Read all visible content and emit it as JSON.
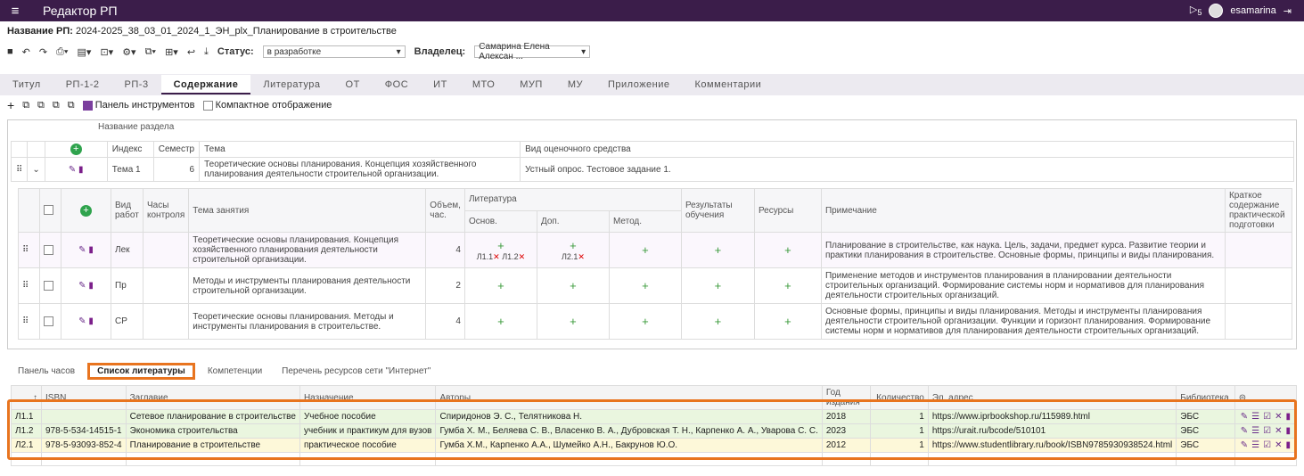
{
  "app": {
    "title": "Редактор РП",
    "user": "esamarina",
    "badge": "5"
  },
  "rp": {
    "label": "Название РП:",
    "value": "2024-2025_38_03_01_2024_1_ЭН_plx_Планирование в строительстве"
  },
  "toolbar": {
    "status_label": "Статус:",
    "status_value": "в разработке",
    "owner_label": "Владелец:",
    "owner_value": "Самарина Елена Алексан ..."
  },
  "tabs": [
    "Титул",
    "РП-1-2",
    "РП-3",
    "Содержание",
    "Литература",
    "ОТ",
    "ФОС",
    "ИТ",
    "МТО",
    "МУП",
    "МУ",
    "Приложение",
    "Комментарии"
  ],
  "tools": {
    "panel_label": "Панель инструментов",
    "compact_label": "Компактное отображение"
  },
  "section": {
    "header": "Название раздела"
  },
  "outer": {
    "headers": {
      "index": "Индекс",
      "semester": "Семестр",
      "theme": "Тема",
      "assess": "Вид оценочного средства"
    },
    "row": {
      "index": "Тема 1",
      "semester": "6",
      "theme": "Теоретические основы планирования. Концепция хозяйственного планирования деятельности строительной организации.",
      "assess": "Устный опрос. Тестовое задание 1."
    }
  },
  "inner": {
    "headers": {
      "type": "Вид работ",
      "hours": "Часы контроля",
      "topic": "Тема занятия",
      "vol": "Объем, час.",
      "lit": "Литература",
      "main": "Основ.",
      "add": "Доп.",
      "meth": "Метод.",
      "results": "Результаты обучения",
      "resources": "Ресурсы",
      "note": "Примечание",
      "summary": "Краткое содержание практической подготовки"
    },
    "rows": [
      {
        "type": "Лек",
        "topic": "Теоретические основы планирования. Концепция хозяйственного планирования деятельности строительной организации.",
        "vol": "4",
        "main_refs": [
          "Л1.1",
          "Л1.2"
        ],
        "add_refs": [
          "Л2.1"
        ],
        "note": "Планирование в строительстве, как наука. Цель, задачи, предмет курса. Развитие теории и практики планирования в строительстве. Основные формы, принципы и виды планирования."
      },
      {
        "type": "Пр",
        "topic": "Методы и инструменты планирования деятельности строительной организации.",
        "vol": "2",
        "note": "Применение методов и инструментов планирования в планировании деятельности строительных организаций. Формирование системы норм и нормативов для планирования деятельности строительных организаций."
      },
      {
        "type": "СР",
        "topic": "Теоретические основы планирования. Методы и инструменты планирования в строительстве.",
        "vol": "4",
        "note": "Основные формы, принципы и виды планирования. Методы и инструменты планирования деятельности строительной организации. Функции и горизонт планирования. Формирование системы норм и нормативов для планирования деятельности строительных организаций."
      }
    ]
  },
  "bottom_tabs": [
    "Панель часов",
    "Список литературы",
    "Компетенции",
    "Перечень ресурсов сети \"Интернет\""
  ],
  "lit": {
    "headers": [
      "↑",
      "ISBN",
      "Заглавие",
      "Назначение",
      "Авторы",
      "Год издания",
      "Количество",
      "Эл. адрес",
      "Библиотека"
    ],
    "rows": [
      [
        "Л1.1",
        "",
        "Сетевое планирование в строительстве",
        "Учебное пособие",
        "Спиридонов Э. С., Телятникова Н.",
        "2018",
        "1",
        "https://www.iprbookshop.ru/115989.html",
        "ЭБС"
      ],
      [
        "Л1.2",
        "978-5-534-14515-1",
        "Экономика строительства",
        "учебник и практикум для вузов",
        "Гумба Х. М., Беляева С. В., Власенко В. А., Дубровская Т. Н., Карпенко А. А., Уварова С. С.",
        "2023",
        "1",
        "https://urait.ru/bcode/510101",
        "ЭБС"
      ],
      [
        "Л2.1",
        "978-5-93093-852-4",
        "Планирование в строительстве",
        "практическое пособие",
        "Гумба Х.М., Карпенко А.А., Шумейко А.Н., Бакрунов Ю.О.",
        "2012",
        "1",
        "https://www.studentlibrary.ru/book/ISBN9785930938524.html",
        "ЭБС"
      ]
    ]
  }
}
